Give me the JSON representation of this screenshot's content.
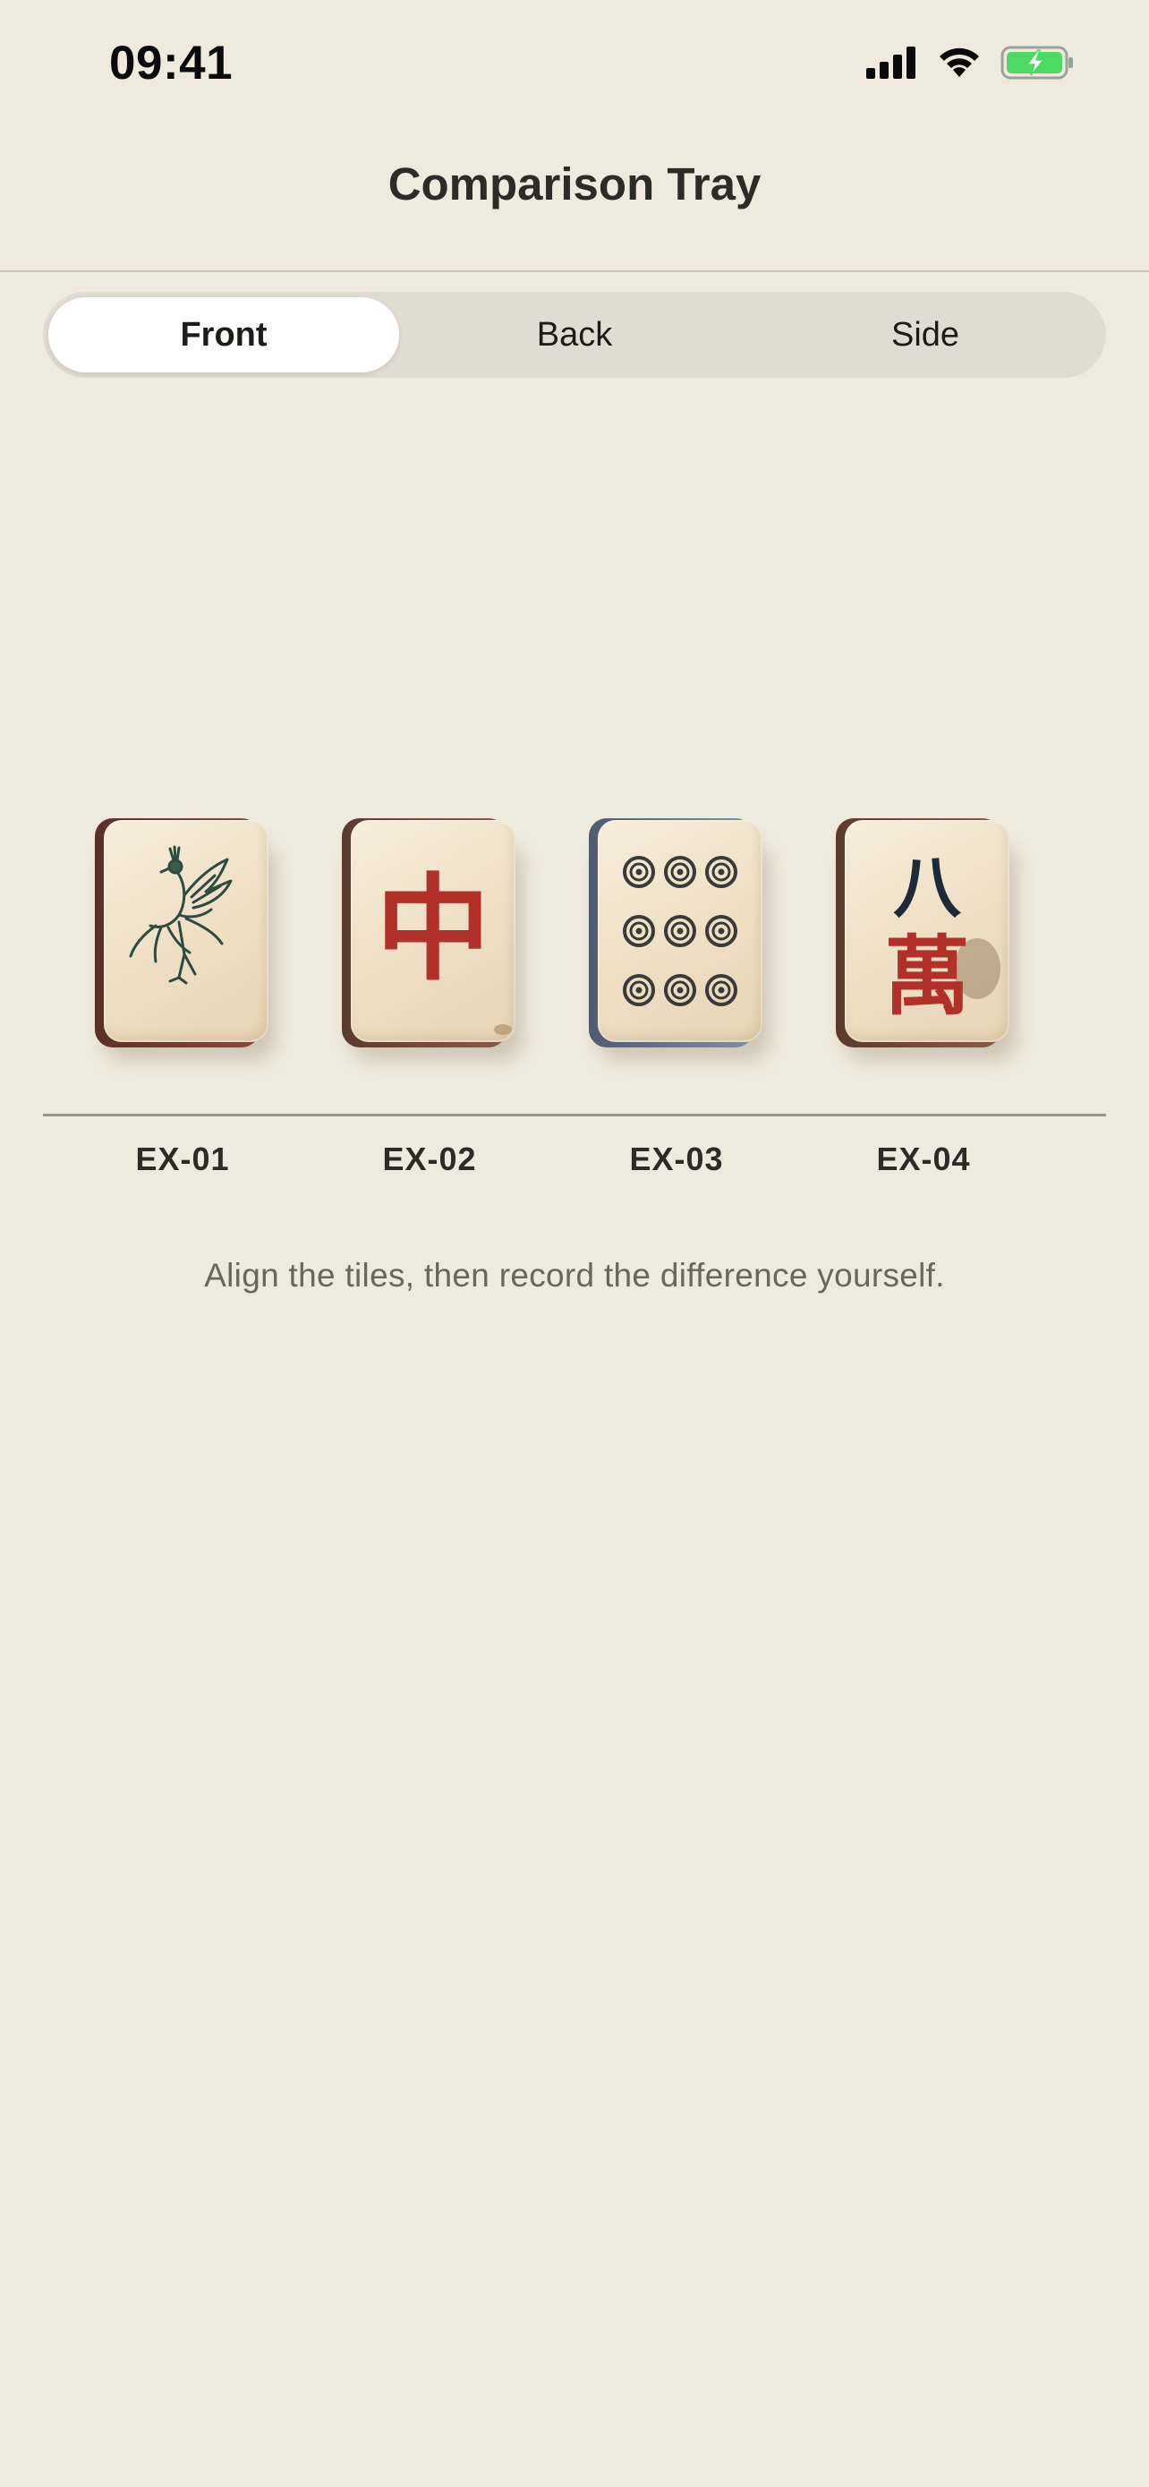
{
  "status_bar": {
    "time": "09:41",
    "icons": [
      "signal-icon",
      "wifi-icon",
      "battery-charging-icon"
    ]
  },
  "header": {
    "title": "Comparison Tray"
  },
  "view_tabs": {
    "items": [
      {
        "label": "Front",
        "selected": true
      },
      {
        "label": "Back",
        "selected": false
      },
      {
        "label": "Side",
        "selected": false
      }
    ]
  },
  "tiles": [
    {
      "label": "EX-01",
      "face": "bird-icon",
      "back_color": "#7C4E3C"
    },
    {
      "label": "EX-02",
      "face": "chinese-character-zhong",
      "glyph": "中",
      "glyph_color": "#B2302A",
      "back_color": "#7C4E3C"
    },
    {
      "label": "EX-03",
      "face": "nine-circles-icon",
      "back_color": "#6F7E92"
    },
    {
      "label": "EX-04",
      "face": "chinese-characters-ba-wan",
      "glyph_top": "八",
      "glyph_bottom": "萬",
      "glyph_top_color": "#1C2A3A",
      "glyph_bottom_color": "#B2302A",
      "back_color": "#7C4E3C"
    }
  ],
  "instruction": "Align the tiles, then record the difference yourself.",
  "colors": {
    "background": "#F0EADE",
    "segment_track": "#E0DCD1",
    "segment_active": "#FFFFFF",
    "battery_fill": "#4CD964"
  }
}
